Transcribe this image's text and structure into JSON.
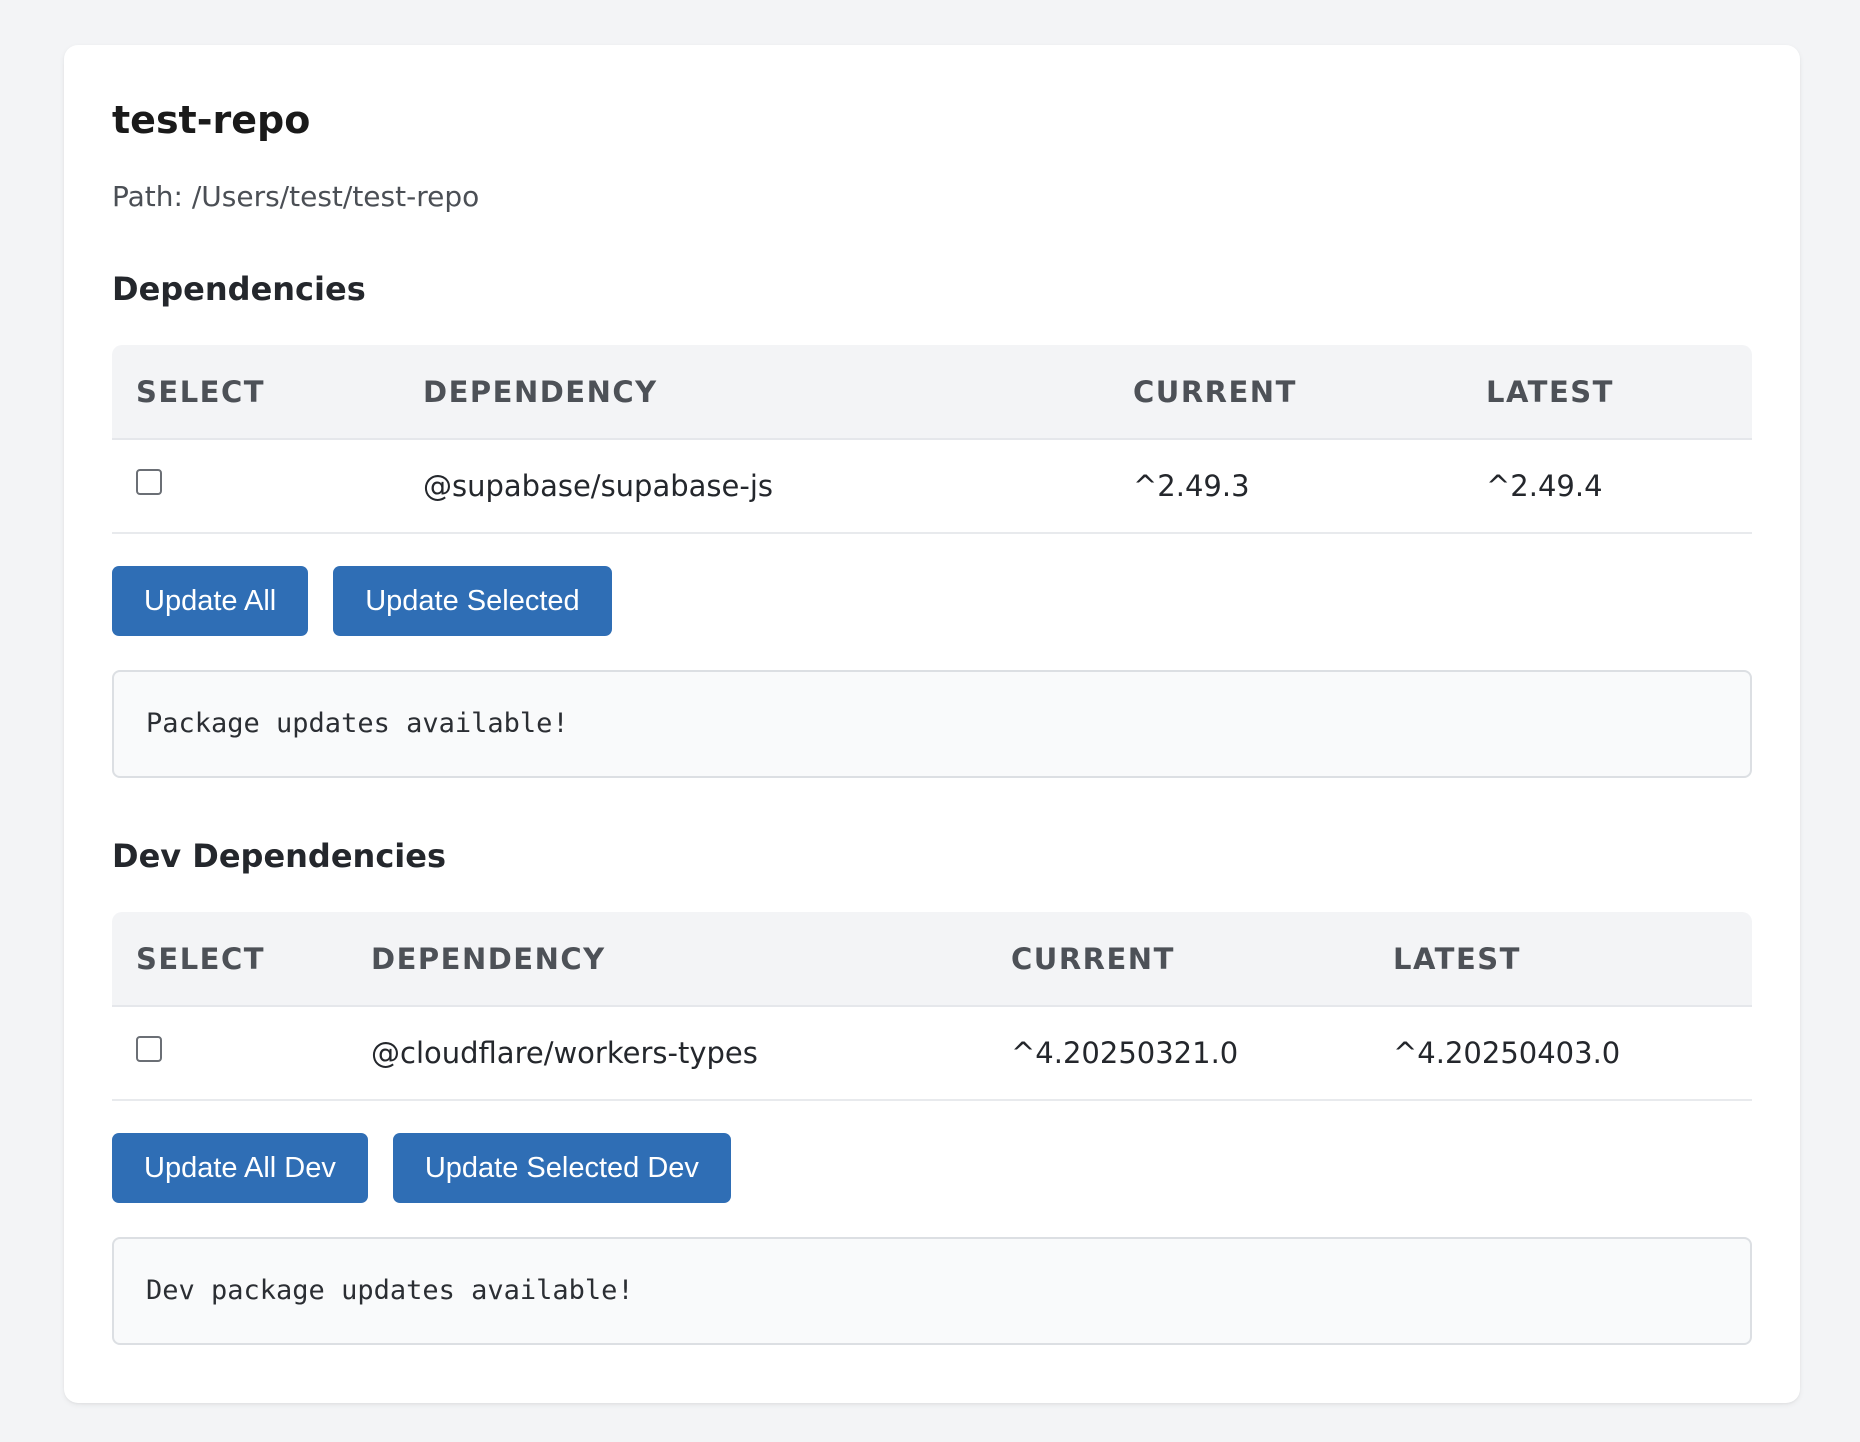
{
  "repo": {
    "title": "test-repo",
    "path": "Path: /Users/test/test-repo"
  },
  "dependencies": {
    "heading": "Dependencies",
    "columns": [
      "SELECT",
      "DEPENDENCY",
      "CURRENT",
      "LATEST"
    ],
    "rows": [
      {
        "name": "@supabase/supabase-js",
        "current": "^2.49.3",
        "latest": "^2.49.4",
        "checked": false
      }
    ],
    "buttons": {
      "update_all": "Update All",
      "update_selected": "Update Selected"
    },
    "status": "Package updates available!"
  },
  "dev_dependencies": {
    "heading": "Dev Dependencies",
    "columns": [
      "SELECT",
      "DEPENDENCY",
      "CURRENT",
      "LATEST"
    ],
    "rows": [
      {
        "name": "@cloudflare/workers-types",
        "current": "^4.20250321.0",
        "latest": "^4.20250403.0",
        "checked": false
      }
    ],
    "buttons": {
      "update_all": "Update All Dev",
      "update_selected": "Update Selected Dev"
    },
    "status": "Dev package updates available!"
  },
  "colors": {
    "accent": "#2f6eb5",
    "background": "#f3f4f6",
    "card": "#ffffff"
  }
}
